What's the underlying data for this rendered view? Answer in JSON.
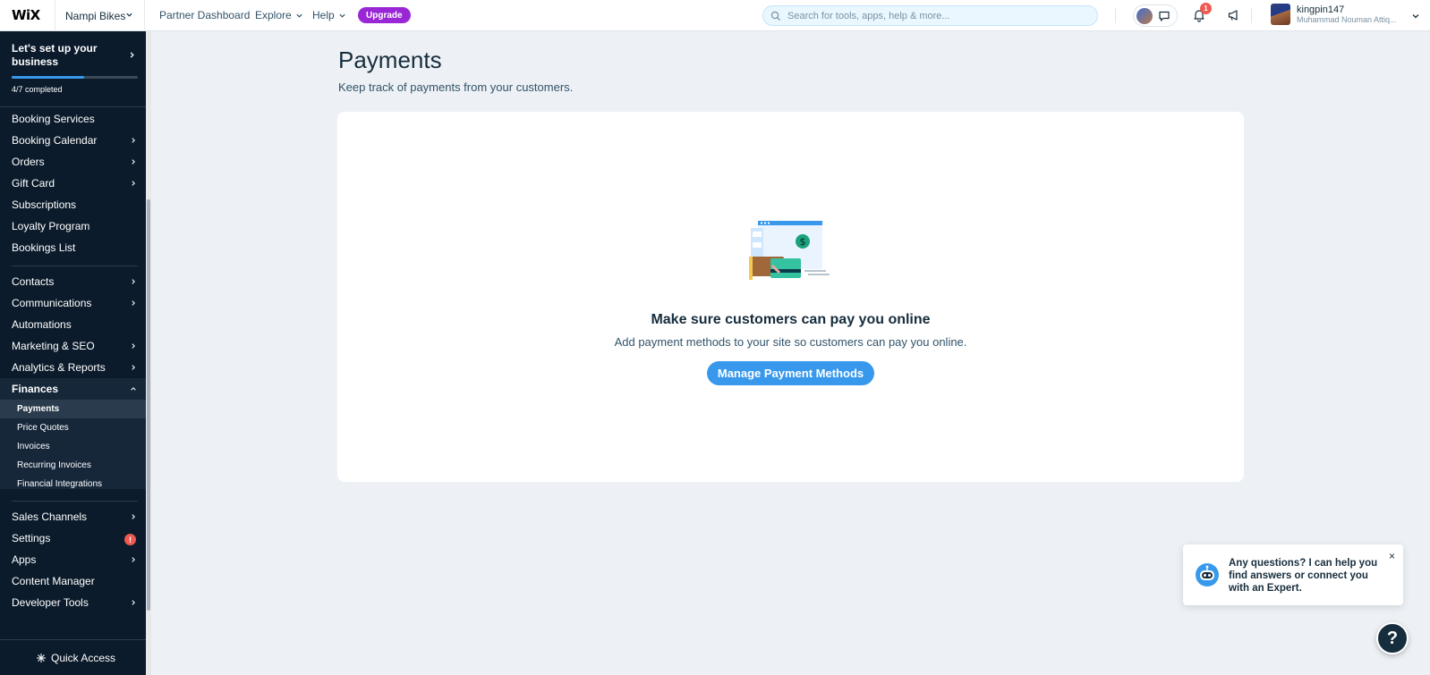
{
  "topbar": {
    "logo": "WiX",
    "site_name": "Nampi Bikes",
    "links": [
      "Partner Dashboard",
      "Explore",
      "Help"
    ],
    "upgrade_label": "Upgrade",
    "search_placeholder": "Search for tools, apps, help & more...",
    "notification_count": "1",
    "user_name": "kingpin147",
    "user_fullname": "Muhammad Nouman Attiq..."
  },
  "sidebar": {
    "setup_title": "Let's set up your business",
    "setup_progress_text": "4/7 completed",
    "setup_progress": 0.571,
    "items": [
      {
        "label": "Booking Services"
      },
      {
        "label": "Booking Calendar"
      },
      {
        "label": "Orders"
      },
      {
        "label": "Gift Card"
      },
      {
        "label": "Subscriptions"
      },
      {
        "label": "Loyalty Program"
      },
      {
        "label": "Bookings List"
      },
      {
        "label": "Contacts"
      },
      {
        "label": "Communications"
      },
      {
        "label": "Automations"
      },
      {
        "label": "Marketing & SEO"
      },
      {
        "label": "Analytics & Reports"
      },
      {
        "label": "Finances"
      },
      {
        "label": "Sales Channels"
      },
      {
        "label": "Settings"
      },
      {
        "label": "Apps"
      },
      {
        "label": "Content Manager"
      },
      {
        "label": "Developer Tools"
      }
    ],
    "finances_sub": [
      "Payments",
      "Price Quotes",
      "Invoices",
      "Recurring Invoices",
      "Financial Integrations"
    ],
    "settings_badge": "!",
    "quick_access": "Quick Access"
  },
  "main": {
    "title": "Payments",
    "subtitle": "Keep track of payments from your customers.",
    "empty_title": "Make sure customers can pay you online",
    "empty_subtitle": "Add payment methods to your site so customers can pay you online.",
    "cta_label": "Manage Payment Methods"
  },
  "assistant": {
    "message": "Any questions? I can help you find answers or connect you with an Expert.",
    "close": "×",
    "help": "?"
  },
  "colors": {
    "accent": "#3899ec",
    "sidebar_bg": "#0b1b2b",
    "upgrade": "#9a27d5",
    "badge": "#ee5951"
  }
}
